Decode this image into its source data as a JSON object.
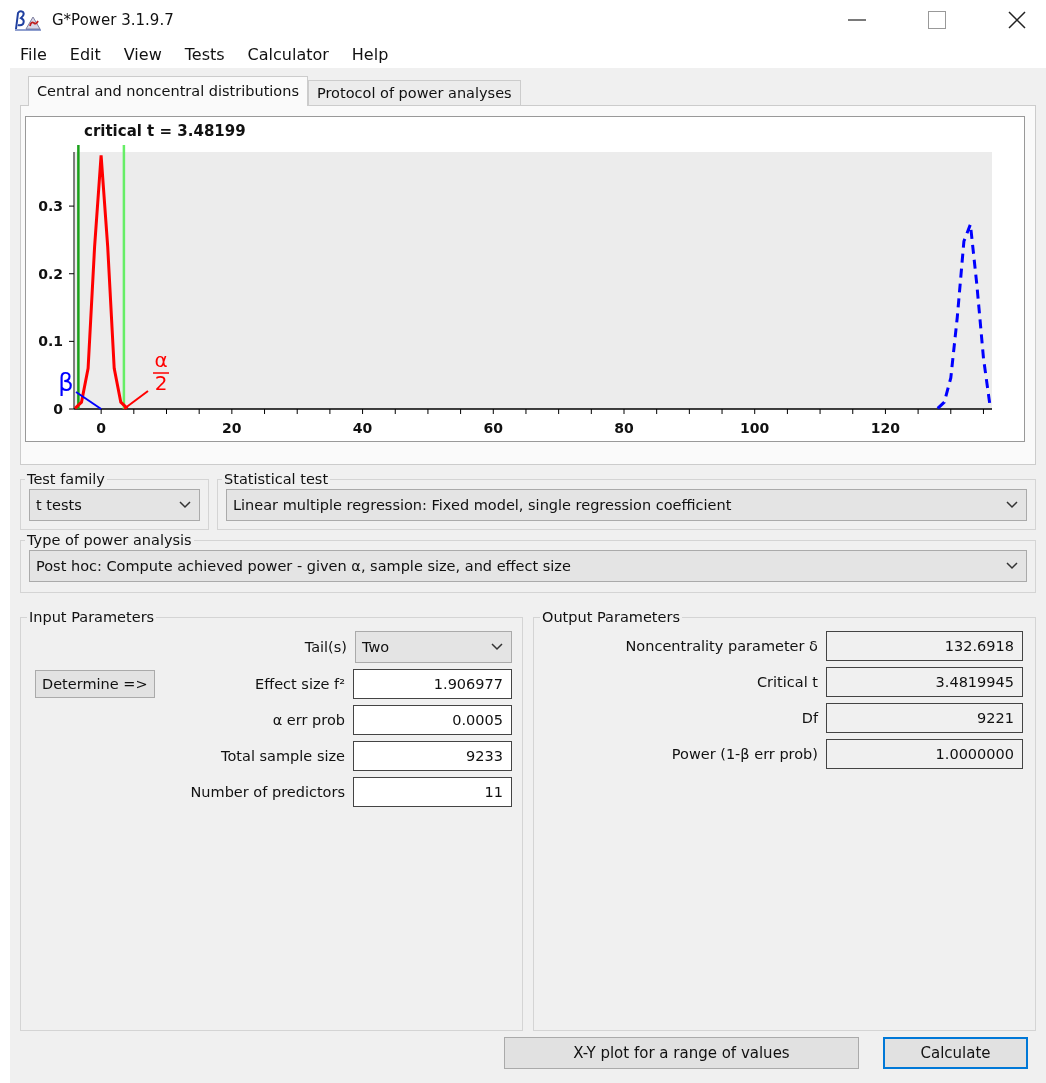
{
  "window": {
    "title": "G*Power 3.1.9.7"
  },
  "menu": [
    "File",
    "Edit",
    "View",
    "Tests",
    "Calculator",
    "Help"
  ],
  "tabs": [
    {
      "label": "Central and noncentral distributions",
      "selected": true
    },
    {
      "label": "Protocol of power analyses",
      "selected": false
    }
  ],
  "chart_data": {
    "type": "line",
    "x": [
      -4,
      -3,
      -2,
      -1,
      0,
      1,
      2,
      3,
      4,
      128,
      129,
      130,
      131,
      132,
      133,
      134,
      135,
      136
    ],
    "series": [
      {
        "color": "#ff0000",
        "line_style": "solid",
        "values": [
          0.001,
          0.01,
          0.06,
          0.24,
          0.375,
          0.24,
          0.06,
          0.01,
          0.001,
          null,
          null,
          null,
          null,
          null,
          null,
          null,
          null,
          null
        ]
      },
      {
        "color": "#0000ff",
        "line_style": "dashed",
        "values": [
          null,
          null,
          null,
          null,
          null,
          null,
          null,
          null,
          null,
          0.001,
          0.01,
          0.046,
          0.136,
          0.248,
          0.273,
          0.183,
          0.075,
          0.005
        ]
      }
    ],
    "xlim": [
      -4,
      136
    ],
    "ylim": [
      0,
      0.38
    ],
    "xticks": [
      0,
      20,
      40,
      60,
      80,
      100,
      120
    ],
    "yticks": [
      0,
      0.1,
      0.2,
      0.3
    ],
    "ref_lines": [
      {
        "axis": "x",
        "value": -3.48199,
        "color": "#1aa01a"
      },
      {
        "axis": "x",
        "value": 3.48199,
        "color": "#66ee66"
      }
    ],
    "annotations": [
      "critical t = 3.48199",
      "β",
      "α",
      "2"
    ]
  },
  "test_family": {
    "label": "Test family",
    "value": "t tests"
  },
  "statistical_test": {
    "label": "Statistical test",
    "value": "Linear multiple regression: Fixed model, single regression coefficient"
  },
  "power_analysis_type": {
    "label": "Type of power analysis",
    "value": "Post hoc: Compute achieved power - given α, sample size, and effect size"
  },
  "input_parameters": {
    "title": "Input Parameters",
    "determine_button": "Determine =>",
    "fields": [
      {
        "label": "Tail(s)",
        "value": "Two",
        "kind": "dropdown"
      },
      {
        "label": "Effect size f²",
        "value": "1.906977",
        "kind": "input"
      },
      {
        "label": "α err prob",
        "value": "0.0005",
        "kind": "input"
      },
      {
        "label": "Total sample size",
        "value": "9233",
        "kind": "input"
      },
      {
        "label": "Number of predictors",
        "value": "11",
        "kind": "input"
      }
    ]
  },
  "output_parameters": {
    "title": "Output Parameters",
    "fields": [
      {
        "label": "Noncentrality parameter δ",
        "value": "132.6918"
      },
      {
        "label": "Critical t",
        "value": "3.4819945"
      },
      {
        "label": "Df",
        "value": "9221"
      },
      {
        "label": "Power (1-β err prob)",
        "value": "1.0000000"
      }
    ]
  },
  "buttons": [
    {
      "label": "X-Y plot for a range of values",
      "focused": false
    },
    {
      "label": "Calculate",
      "focused": true
    }
  ]
}
